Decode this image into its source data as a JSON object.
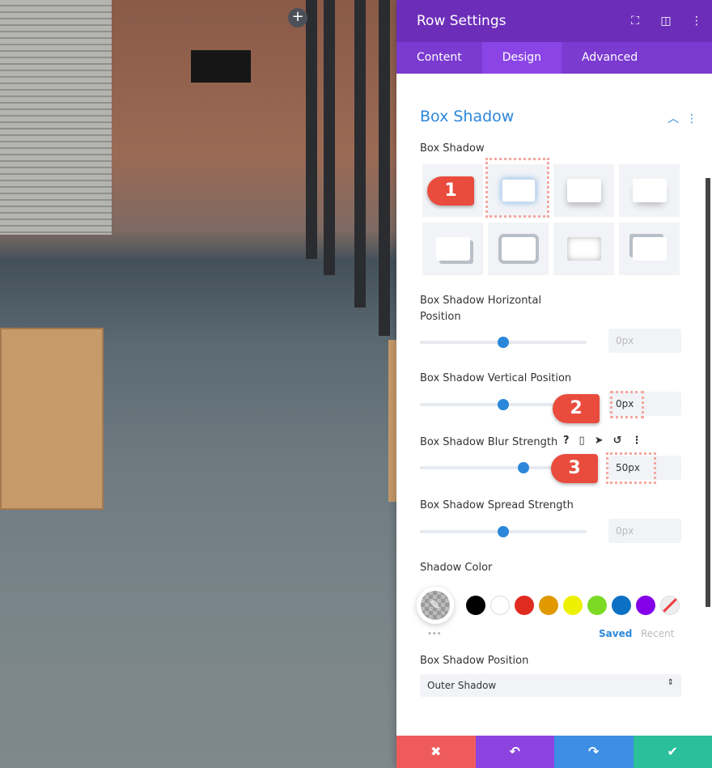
{
  "header": {
    "title": "Row Settings",
    "icons": [
      "expand-icon",
      "sidebar-layout-icon",
      "more-icon"
    ]
  },
  "tabs": [
    {
      "label": "Content"
    },
    {
      "label": "Design",
      "active": true
    },
    {
      "label": "Advanced"
    }
  ],
  "section": {
    "title": "Box Shadow"
  },
  "box_shadow": {
    "label": "Box Shadow",
    "selected_preset": 1,
    "preset_count": 8
  },
  "horizontal": {
    "label": "Box Shadow Horizontal Position",
    "value": "0px",
    "slider": 0.5
  },
  "vertical": {
    "label": "Box Shadow Vertical Position",
    "value": "0px",
    "slider": 0.5
  },
  "blur": {
    "label": "Box Shadow Blur Strength",
    "value": "50px",
    "slider": 0.62
  },
  "spread": {
    "label": "Box Shadow Spread Strength",
    "value": "0px",
    "slider": 0.5
  },
  "shadow_color": {
    "label": "Shadow Color",
    "swatches": [
      "#000000",
      "#ffffff",
      "#e02b20",
      "#e09900",
      "#edf000",
      "#7cda24",
      "#0c71c3",
      "#8300e9"
    ],
    "saved": "Saved",
    "recent": "Recent",
    "more": "•••"
  },
  "position": {
    "label": "Box Shadow Position",
    "value": "Outer Shadow"
  },
  "annotations": [
    "1",
    "2",
    "3"
  ],
  "footer": {
    "colors": [
      "#ef5b5b",
      "#8d43e0",
      "#3d8ee4",
      "#2bbf9b"
    ],
    "icons": [
      "close-icon",
      "undo-icon",
      "redo-icon",
      "check-icon"
    ]
  },
  "canvas": {
    "add_button": "+"
  }
}
